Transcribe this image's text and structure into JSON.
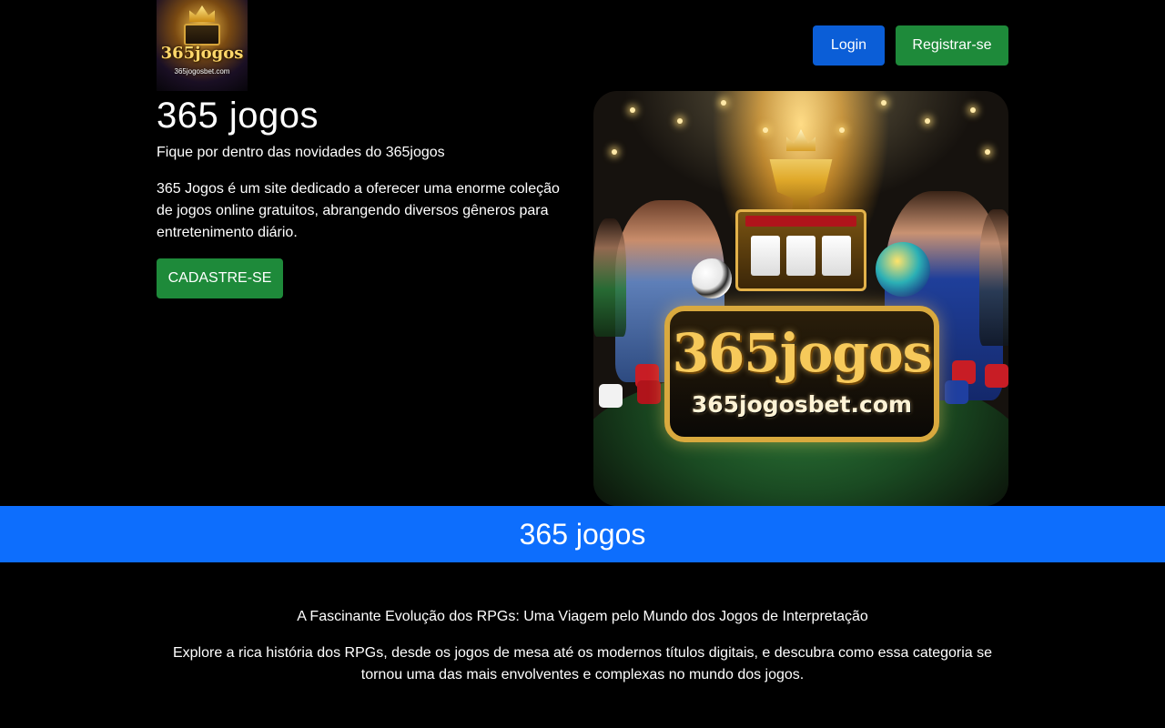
{
  "header": {
    "logo": {
      "title": "365jogos",
      "url": "365jogosbet.com"
    },
    "login_label": "Login",
    "register_label": "Registrar-se"
  },
  "hero": {
    "title": "365 jogos",
    "subtitle": "Fique por dentro das novidades do 365jogos",
    "description": "365 Jogos é um site dedicado a oferecer uma enorme coleção de jogos online gratuitos, abrangendo diversos gêneros para entretenimento diário.",
    "cta_label": "CADASTRE-SE",
    "image": {
      "sign_title": "365jogos",
      "sign_url": "365jogosbet.com"
    }
  },
  "banner": {
    "title": "365 jogos"
  },
  "article": {
    "title": "A Fascinante Evolução dos RPGs: Uma Viagem pelo Mundo dos Jogos de Interpretação",
    "description": "Explore a rica história dos RPGs, desde os jogos de mesa até os modernos títulos digitais, e descubra como essa categoria se tornou uma das mais envolventes e complexas no mundo dos jogos."
  },
  "colors": {
    "background": "#000000",
    "login_button": "#0b5ed7",
    "register_button": "#1e8a3a",
    "cta_button": "#1e8a3a",
    "banner": "#0d6efd",
    "text": "#ffffff"
  }
}
